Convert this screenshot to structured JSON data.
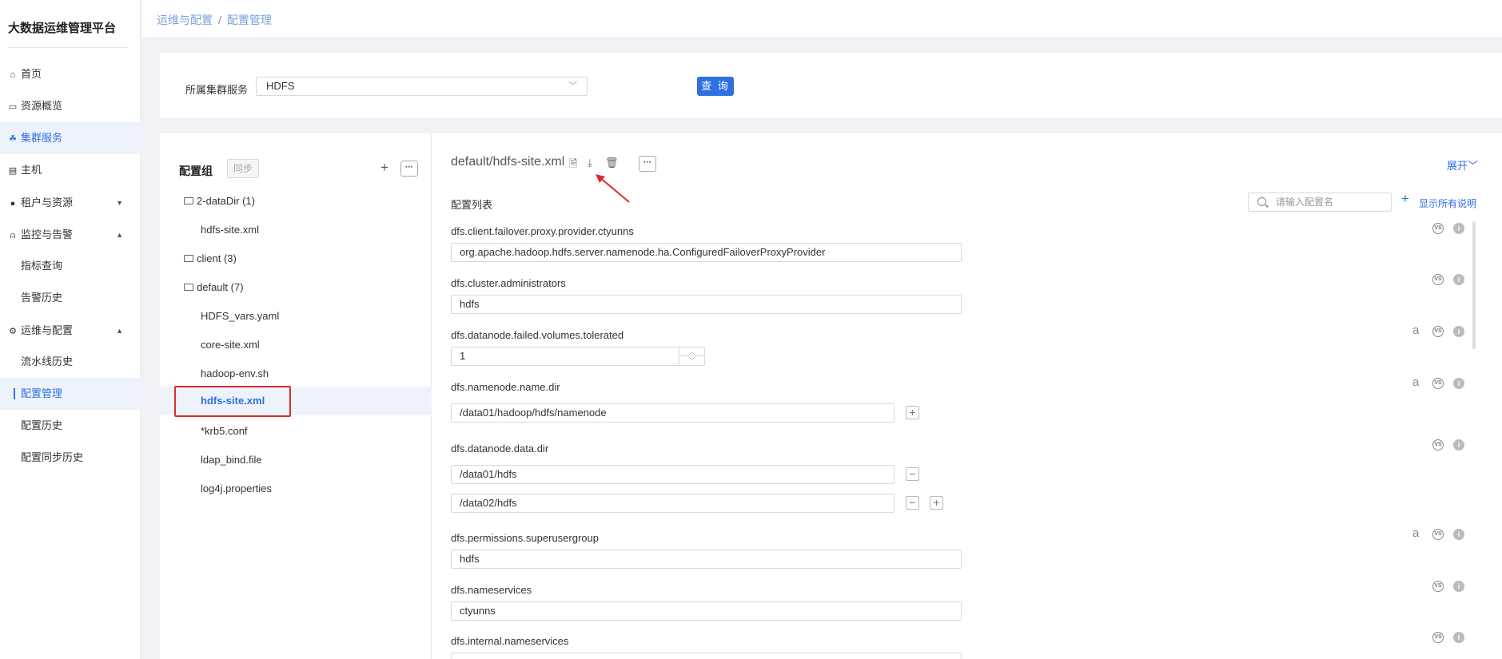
{
  "app_title": "大数据运维管理平台",
  "nav": [
    {
      "icon": "home-icon",
      "glyph": "⌂",
      "label": "首页"
    },
    {
      "icon": "monitor-icon",
      "glyph": "▭",
      "label": "资源概览"
    },
    {
      "icon": "cluster-icon",
      "glyph": "☘",
      "label": "集群服务"
    },
    {
      "icon": "server-icon",
      "glyph": "▤",
      "label": "主机"
    },
    {
      "icon": "user-icon",
      "glyph": "●",
      "label": "租户与资源"
    },
    {
      "icon": "bell-icon",
      "glyph": "⍝",
      "label": "监控与告警"
    },
    {
      "label": "指标查询"
    },
    {
      "label": "告警历史"
    },
    {
      "icon": "gear-icon",
      "glyph": "⚙",
      "label": "运维与配置"
    },
    {
      "label": "流水线历史"
    },
    {
      "label": "配置管理"
    },
    {
      "label": "配置历史"
    },
    {
      "label": "配置同步历史"
    }
  ],
  "breadcrumb": {
    "parent": "运维与配置",
    "separator": "/",
    "current": "配置管理"
  },
  "filter": {
    "label": "所属集群服务",
    "selected": "HDFS",
    "query_button": "查 询"
  },
  "groups": {
    "title": "配置组",
    "sync_button": "同步",
    "add": "+",
    "more": "···",
    "tree": [
      {
        "type": "folder",
        "label": "2-dataDir (1)"
      },
      {
        "type": "file",
        "label": "hdfs-site.xml"
      },
      {
        "type": "folder",
        "label": "client (3)"
      },
      {
        "type": "folder",
        "label": "default (7)"
      },
      {
        "type": "file",
        "label": "HDFS_vars.yaml"
      },
      {
        "type": "file",
        "label": "core-site.xml"
      },
      {
        "type": "file",
        "label": "hadoop-env.sh"
      },
      {
        "type": "file",
        "label": "hdfs-site.xml"
      },
      {
        "type": "file",
        "label": "*krb5.conf"
      },
      {
        "type": "file",
        "label": "ldap_bind.file"
      },
      {
        "type": "file",
        "label": "log4j.properties"
      }
    ]
  },
  "config": {
    "file_title": "default/hdfs-site.xml",
    "more": "···",
    "expand": "展开",
    "list_title": "配置列表",
    "search_placeholder": "请输入配置名",
    "add": "+",
    "show_all": "显示所有说明",
    "vs_label": "VS",
    "info_label": "i",
    "a_label": "a",
    "params": [
      {
        "name": "dfs.client.failover.proxy.provider.ctyunns",
        "value": "org.apache.hadoop.hdfs.server.namenode.ha.ConfiguredFailoverProxyProvider"
      },
      {
        "name": "dfs.cluster.administrators",
        "value": "hdfs"
      },
      {
        "name": "dfs.datanode.failed.volumes.tolerated",
        "value": "1"
      },
      {
        "name": "dfs.namenode.name.dir",
        "value": "/data01/hadoop/hdfs/namenode"
      },
      {
        "name": "dfs.datanode.data.dir",
        "values": [
          "/data01/hdfs",
          "/data02/hdfs"
        ]
      },
      {
        "name": "dfs.permissions.superusergroup",
        "value": "hdfs"
      },
      {
        "name": "dfs.nameservices",
        "value": "ctyunns"
      },
      {
        "name": "dfs.internal.nameservices",
        "value": ""
      }
    ]
  }
}
